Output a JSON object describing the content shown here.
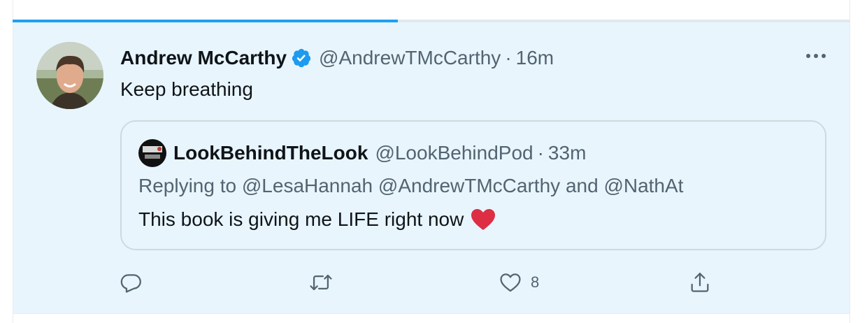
{
  "tweet": {
    "author_name": "Andrew McCarthy",
    "author_handle": "@AndrewTMcCarthy",
    "separator": "·",
    "time": "16m",
    "text": "Keep breathing"
  },
  "quoted_tweet": {
    "author_name": "LookBehindTheLook",
    "author_handle": "@LookBehindPod",
    "separator": "·",
    "time": "33m",
    "replying_prefix": "Replying to",
    "replying_mentions": [
      "@LesaHannah",
      "@AndrewTMcCarthy"
    ],
    "replying_and": "and",
    "replying_last": "@NathAt",
    "text": "This book is giving me LIFE right now",
    "emoji": "red-heart"
  },
  "actions": {
    "reply_icon": "reply-icon",
    "retweet_icon": "retweet-icon",
    "like_icon": "like-icon",
    "like_count": "8",
    "share_icon": "share-icon"
  },
  "progress": {
    "fraction": 0.46
  },
  "colors": {
    "accent": "#1da1f2",
    "verified": "#1d9bf0",
    "highlight_bg": "#e8f5fd",
    "secondary_text": "#536471",
    "heart": "#e0245e"
  }
}
